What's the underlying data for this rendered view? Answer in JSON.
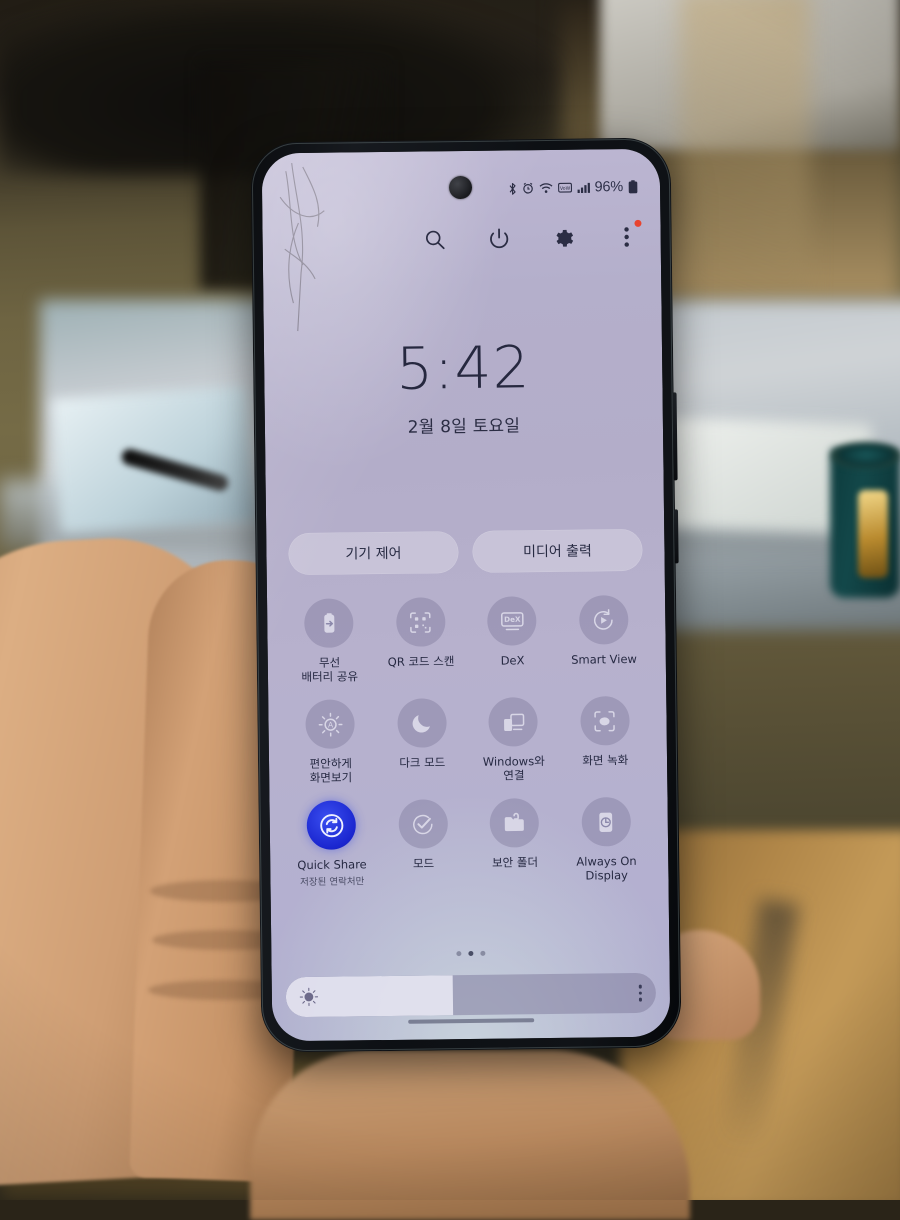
{
  "device": {
    "label": "samsung-galaxy-phone",
    "held_in_hand": true,
    "screen_cracked": true
  },
  "status_bar": {
    "icons": [
      "bluetooth-icon",
      "alarm-icon",
      "wifi-icon",
      "vowifi-icon",
      "signal-icon"
    ],
    "battery_percent": "96%"
  },
  "quick_panel": {
    "actions": [
      {
        "name": "search-icon",
        "label": "Search"
      },
      {
        "name": "power-icon",
        "label": "Power"
      },
      {
        "name": "settings-gear-icon",
        "label": "Settings"
      },
      {
        "name": "more-options-icon",
        "label": "More options",
        "badge": true
      }
    ],
    "clock": {
      "time": "5:42",
      "date": "2월 8일 토요일"
    },
    "pills": [
      {
        "label": "기기 제어",
        "name": "device-control-button"
      },
      {
        "label": "미디어 출력",
        "name": "media-output-button"
      }
    ],
    "tiles": [
      {
        "label": "무선\n배터리 공유",
        "icon": "wireless-power-share-icon",
        "on": false
      },
      {
        "label": "QR 코드 스캔",
        "icon": "qr-code-scan-icon",
        "on": false
      },
      {
        "label": "DeX",
        "icon": "dex-icon",
        "on": false
      },
      {
        "label": "Smart View",
        "icon": "smart-view-icon",
        "on": false
      },
      {
        "label": "편안하게\n화면보기",
        "icon": "eye-comfort-shield-icon",
        "on": false
      },
      {
        "label": "다크 모드",
        "icon": "dark-mode-moon-icon",
        "on": false
      },
      {
        "label": "Windows와\n연결",
        "icon": "link-to-windows-icon",
        "on": false
      },
      {
        "label": "화면 녹화",
        "icon": "screen-recorder-icon",
        "on": false
      },
      {
        "label": "Quick Share",
        "sublabel": "저장된 연락처만",
        "icon": "quick-share-icon",
        "on": true
      },
      {
        "label": "모드",
        "icon": "modes-icon",
        "on": false
      },
      {
        "label": "보안 폴더",
        "icon": "secure-folder-icon",
        "on": false
      },
      {
        "label": "Always On\nDisplay",
        "icon": "always-on-display-icon",
        "on": false
      }
    ],
    "page_dots": {
      "count": 3,
      "active_index": 1
    },
    "brightness": {
      "percent": 45,
      "icon": "brightness-sun-icon",
      "more_icon": "brightness-more-icon"
    }
  },
  "colors": {
    "screen_background": "#b4afcb",
    "accent_active": "#1a26cf",
    "text_primary": "#26283f",
    "tile_inactive": "rgba(122,118,152,0.40)",
    "badge_red": "#e8442f"
  }
}
